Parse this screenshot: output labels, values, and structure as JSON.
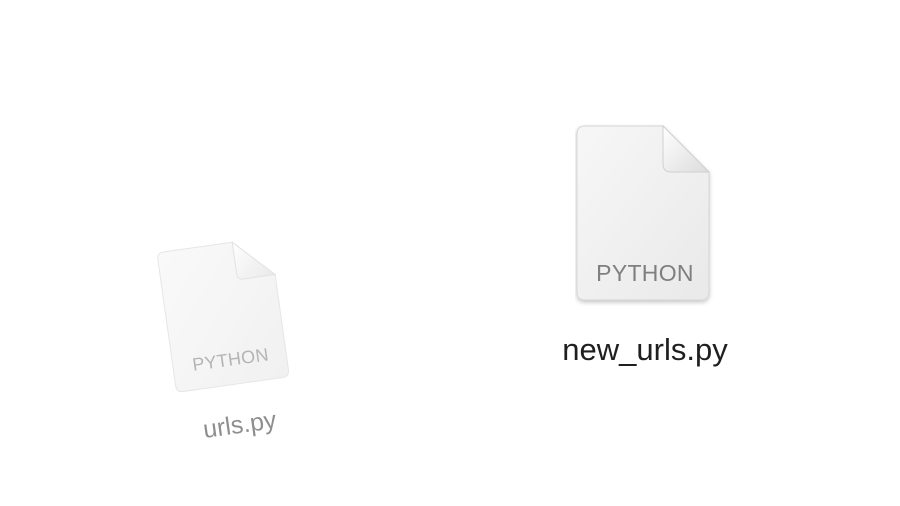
{
  "files": [
    {
      "name": "new_urls.py",
      "kind_label": "PYTHON",
      "icon": "python-document-icon"
    },
    {
      "name": "urls.py",
      "kind_label": "PYTHON",
      "icon": "python-document-icon",
      "state": "dragging"
    }
  ],
  "colors": {
    "background": "#ffffff",
    "document_fill": "#f2f2f2",
    "label_text": "#1f1f1f",
    "kind_text": "#7f7f7f"
  }
}
